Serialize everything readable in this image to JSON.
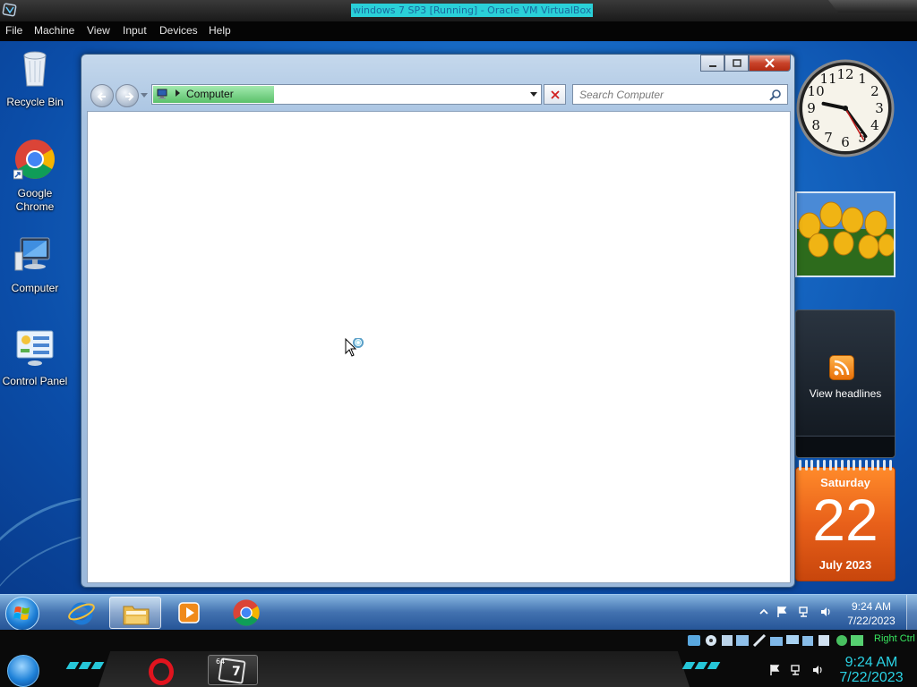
{
  "host": {
    "title": "windows 7 SP3 [Running] - Oracle VM VirtualBox",
    "menu": [
      "File",
      "Machine",
      "View",
      "Input",
      "Devices",
      "Help"
    ],
    "status_label": "Right Ctrl",
    "clock": {
      "time": "9:24 AM",
      "date": "7/22/2023"
    },
    "vbox_badge": "64",
    "vbox_badge_num": "7"
  },
  "desktop": {
    "icons": [
      {
        "label": "Recycle Bin",
        "icon": "recycle-bin-icon"
      },
      {
        "label": "Google Chrome",
        "icon": "chrome-icon"
      },
      {
        "label": "Computer",
        "icon": "computer-icon"
      },
      {
        "label": "Control Panel",
        "icon": "control-panel-icon"
      }
    ]
  },
  "explorer": {
    "address": "Computer",
    "address_progress": 0.31,
    "search_placeholder": "Search Computer"
  },
  "gadgets": {
    "clock": {
      "hour": 9,
      "minute": 24,
      "second": 25
    },
    "feed_label": "View headlines",
    "calendar": {
      "weekday": "Saturday",
      "day": "22",
      "month": "July 2023"
    }
  },
  "taskbar": {
    "clock": {
      "time": "9:24 AM",
      "date": "7/22/2023"
    },
    "pinned": [
      "internet-explorer-icon",
      "windows-explorer-icon",
      "media-player-icon",
      "chrome-icon"
    ],
    "active_index": 1
  },
  "colors": {
    "accent_taskbar": "#2f6fb8",
    "close_red": "#c9432a",
    "calendar_orange": "#e8601a",
    "host_clock_cyan": "#2ad2e4",
    "right_ctrl_green": "#38e860"
  }
}
